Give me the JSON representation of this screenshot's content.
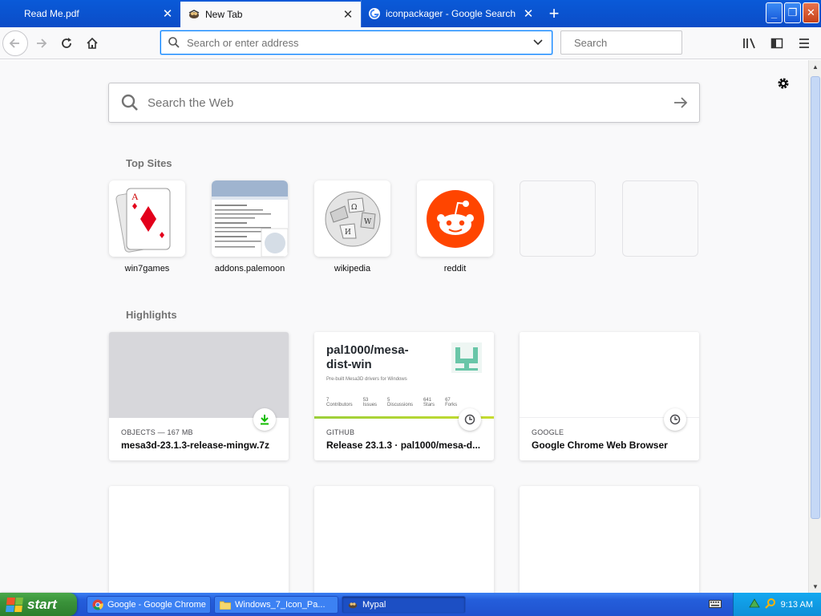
{
  "tabs": [
    {
      "title": "Read Me.pdf",
      "active": false
    },
    {
      "title": "New Tab",
      "active": true
    },
    {
      "title": "iconpackager - Google Search",
      "active": false
    }
  ],
  "toolbar": {
    "url_placeholder": "Search or enter address",
    "search_placeholder": "Search"
  },
  "newtab": {
    "web_search_placeholder": "Search the Web",
    "top_sites_title": "Top Sites",
    "top_sites": [
      {
        "label": "win7games",
        "icon": "playing-card-icon"
      },
      {
        "label": "addons.palemoon",
        "icon": "page-screenshot-icon"
      },
      {
        "label": "wikipedia",
        "icon": "wikipedia-globe-icon"
      },
      {
        "label": "reddit",
        "icon": "reddit-alien-icon"
      },
      {
        "label": "",
        "icon": ""
      },
      {
        "label": "",
        "icon": ""
      }
    ],
    "highlights_title": "Highlights",
    "highlights": [
      {
        "context": "OBJECTS — 167 MB",
        "title": "mesa3d-23.1.3-release-mingw.7z",
        "badge": "download-icon"
      },
      {
        "context": "GITHUB",
        "title": "Release 23.1.3 · pal1000/mesa-d...",
        "badge": "clock-icon",
        "preview": {
          "repo": "pal1000/mesa-dist-win",
          "desc": "Pre-built Mesa3D drivers for Windows",
          "stats": [
            {
              "n": "7",
              "l": "Contributors"
            },
            {
              "n": "53",
              "l": "Issues"
            },
            {
              "n": "5",
              "l": "Discussions"
            },
            {
              "n": "641",
              "l": "Stars"
            },
            {
              "n": "67",
              "l": "Forks"
            }
          ]
        }
      },
      {
        "context": "GOOGLE",
        "title": "Google Chrome Web Browser",
        "badge": "clock-icon"
      }
    ]
  },
  "taskbar": {
    "start_label": "start",
    "items": [
      {
        "label": "Google - Google Chrome",
        "icon": "chrome-icon"
      },
      {
        "label": "Windows_7_Icon_Pa...",
        "icon": "folder-icon"
      },
      {
        "label": "Mypal",
        "icon": "mypal-icon"
      }
    ],
    "clock": "9:13 AM"
  },
  "colors": {
    "tabbar": "#0b4cc7",
    "accent": "#0a84ff",
    "download": "#12bc00",
    "reddit": "#ff4500"
  }
}
